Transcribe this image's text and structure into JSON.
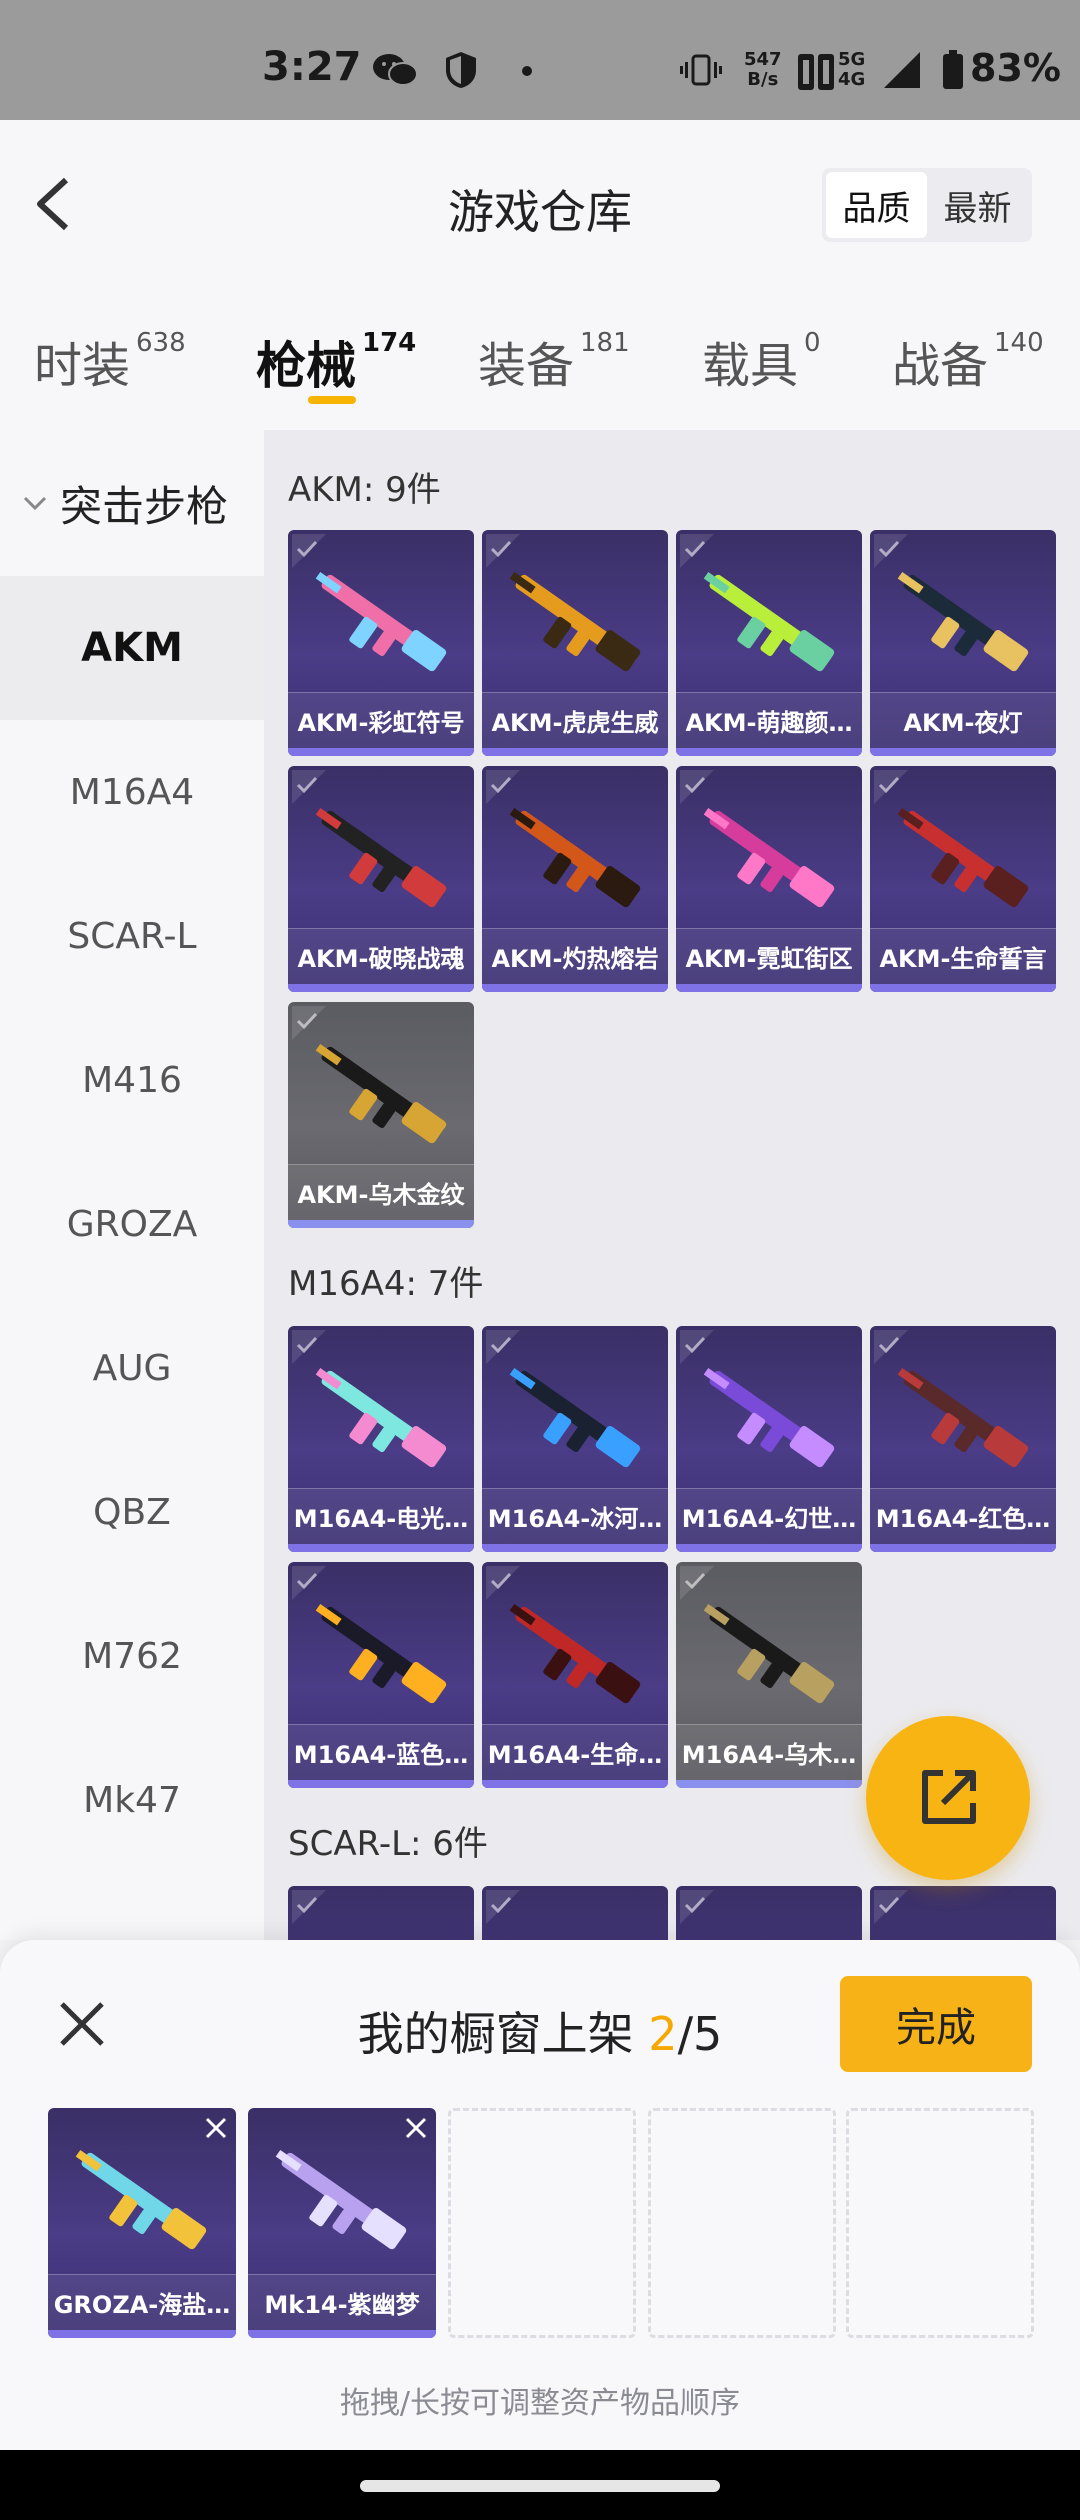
{
  "status_bar": {
    "time": "3:27",
    "net_speed_value": "547",
    "net_speed_unit": "B/s",
    "network_top": "5G",
    "network_bottom": "4G",
    "battery": "83%"
  },
  "header": {
    "title": "游戏仓库",
    "sort_options": [
      "品质",
      "最新"
    ],
    "active_sort": "品质"
  },
  "tabs": [
    {
      "label": "时装",
      "count": "638"
    },
    {
      "label": "枪械",
      "count": "174",
      "active": true
    },
    {
      "label": "装备",
      "count": "181"
    },
    {
      "label": "载具",
      "count": "0"
    },
    {
      "label": "战备",
      "count": "140"
    }
  ],
  "sidebar": {
    "group": "突击步枪",
    "items": [
      "AKM",
      "M16A4",
      "SCAR-L",
      "M416",
      "GROZA",
      "AUG",
      "QBZ",
      "M762",
      "Mk47"
    ],
    "active": "AKM"
  },
  "sections": [
    {
      "title": "AKM: 9件",
      "items": [
        "AKM-彩虹符号",
        "AKM-虎虎生威",
        "AKM-萌趣颜…",
        "AKM-夜灯",
        "AKM-破晓战魂",
        "AKM-灼热熔岩",
        "AKM-霓虹街区",
        "AKM-生命誓言",
        "AKM-乌木金纹"
      ]
    },
    {
      "title": "M16A4: 7件",
      "items": [
        "M16A4-电光…",
        "M16A4-冰河…",
        "M16A4-幻世…",
        "M16A4-红色…",
        "M16A4-蓝色…",
        "M16A4-生命…",
        "M16A4-乌木…"
      ]
    },
    {
      "title": "SCAR-L: 6件",
      "items": []
    }
  ],
  "showcase": {
    "title_prefix": "我的橱窗上架",
    "current": "2",
    "total": "/5",
    "done_label": "完成",
    "slots": [
      "GROZA-海盐…",
      "Mk14-紫幽梦"
    ],
    "hint": "拖拽/长按可调整资产物品顺序"
  },
  "colors": {
    "accent": "#f7b217",
    "card_purple": "#3f3476",
    "card_gray": "#616168"
  }
}
